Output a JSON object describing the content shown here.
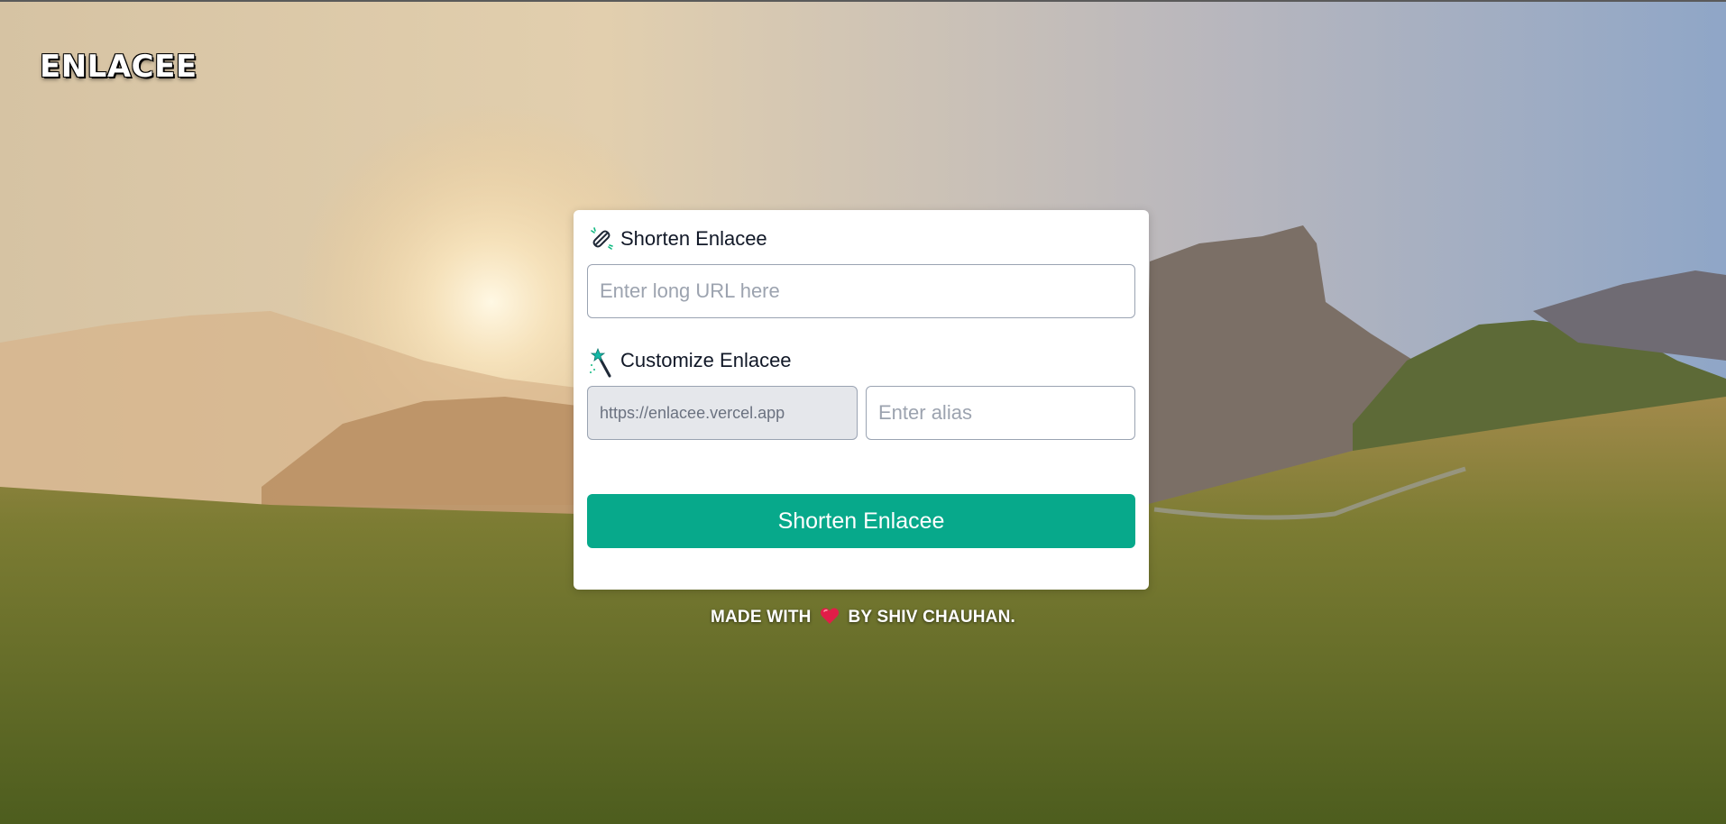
{
  "header": {
    "brand": "ENLACEE"
  },
  "shorten": {
    "label": "Shorten Enlacee",
    "icon": "link-icon",
    "url_placeholder": "Enter long URL here"
  },
  "customize": {
    "label": "Customize Enlacee",
    "icon": "magic-wand-icon",
    "prefix_value": "https://enlacee.vercel.app",
    "alias_placeholder": "Enter alias"
  },
  "submit_label": "Shorten Enlacee",
  "footer": {
    "before": "MADE WITH",
    "heart_icon": "heart-icon",
    "after": "BY SHIV CHAUHAN."
  },
  "colors": {
    "accent": "#07a98b",
    "card": "#ffffff",
    "prefix_bg": "#e5e7eb"
  }
}
